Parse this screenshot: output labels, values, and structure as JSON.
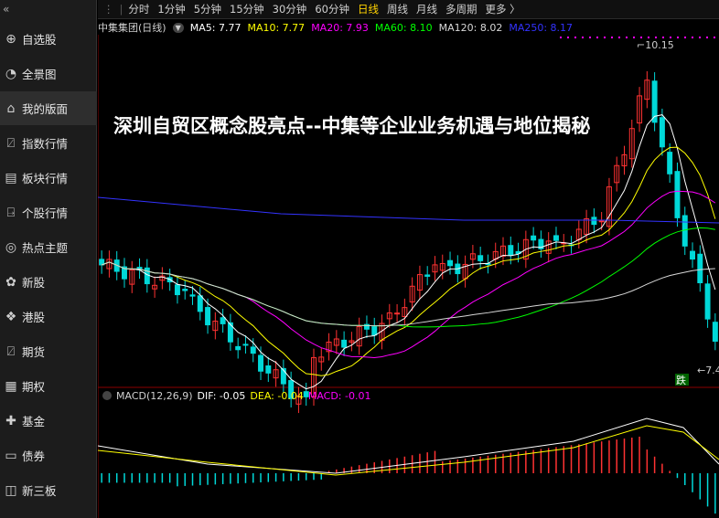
{
  "sidebar": {
    "collapse_glyph": "«",
    "items": [
      {
        "label": "自选股",
        "icon": "plus-circle-icon",
        "glyph": "⊕"
      },
      {
        "label": "全景图",
        "icon": "pie-chart-icon",
        "glyph": "◔"
      },
      {
        "label": "我的版面",
        "icon": "home-icon",
        "glyph": "⌂"
      },
      {
        "label": "指数行情",
        "icon": "index-chart-icon",
        "glyph": "⍁"
      },
      {
        "label": "板块行情",
        "icon": "sector-icon",
        "glyph": "▤"
      },
      {
        "label": "个股行情",
        "icon": "stock-monitor-icon",
        "glyph": "⍈"
      },
      {
        "label": "热点主题",
        "icon": "target-icon",
        "glyph": "◎"
      },
      {
        "label": "新股",
        "icon": "new-stock-icon",
        "glyph": "✿"
      },
      {
        "label": "港股",
        "icon": "hk-stock-icon",
        "glyph": "❖"
      },
      {
        "label": "期货",
        "icon": "futures-chart-icon",
        "glyph": "⍁"
      },
      {
        "label": "期权",
        "icon": "options-icon",
        "glyph": "▦"
      },
      {
        "label": "基金",
        "icon": "fund-icon",
        "glyph": "✚"
      },
      {
        "label": "债券",
        "icon": "bond-icon",
        "glyph": "▭"
      },
      {
        "label": "新三板",
        "icon": "neeq-icon",
        "glyph": "◫"
      }
    ],
    "active_index": 2
  },
  "periodbar": {
    "items": [
      "分时",
      "1分钟",
      "5分钟",
      "15分钟",
      "30分钟",
      "60分钟",
      "日线",
      "周线",
      "月线",
      "多周期",
      "更多 〉"
    ],
    "active_index": 6
  },
  "ma_bar": {
    "stock": "中集集团(日线)",
    "menu_glyph": "▼",
    "items": [
      {
        "text": "MA5: 7.77",
        "color": "#ffffff"
      },
      {
        "text": "MA10: 7.77",
        "color": "#ffff00"
      },
      {
        "text": "MA20: 7.93",
        "color": "#ff00ff"
      },
      {
        "text": "MA60: 8.10",
        "color": "#00ff00"
      },
      {
        "text": "MA120: 8.02",
        "color": "#d8d8d8"
      },
      {
        "text": "MA250: 8.17",
        "color": "#3333ff"
      }
    ]
  },
  "overlay": {
    "headline": "深圳自贸区概念股亮点--中集等企业业务机遇与地位揭秘"
  },
  "macd_bar": {
    "items": [
      {
        "text": "MACD(12,26,9)",
        "color": "#d0d0d0"
      },
      {
        "text": "DIF: -0.05",
        "color": "#ffffff"
      },
      {
        "text": "DEA: -0.04",
        "color": "#ffff00"
      },
      {
        "text": "MACD: -0.01",
        "color": "#ff00ff"
      }
    ]
  },
  "chart_data": {
    "type": "candlestick",
    "price_range": [
      7.3,
      10.4
    ],
    "annotations": {
      "high": "10.15",
      "low": "7.4",
      "badge": "跌"
    },
    "colors": {
      "up": "#ff3232",
      "down": "#00d8d8",
      "ma5": "#ffffff",
      "ma10": "#ffff00",
      "ma20": "#ff00ff",
      "ma60": "#00ff00",
      "ma120": "#d8d8d8",
      "ma250": "#3333ff"
    }
  }
}
